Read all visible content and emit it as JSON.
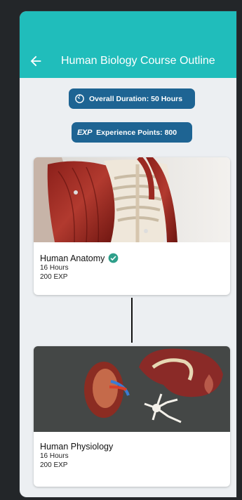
{
  "appbar": {
    "title": "Human Biology Course Outline",
    "back_icon": "arrow-left-icon"
  },
  "summary": {
    "duration_label": "Overall Duration: 50 Hours",
    "exp_badge": "EXP",
    "exp_label": "Experience Points: 800"
  },
  "modules": [
    {
      "name": "Human Anatomy",
      "hours": "16 Hours",
      "exp": "200 EXP",
      "completed": true
    },
    {
      "name": "Human Physiology",
      "hours": "16 Hours",
      "exp": "200 EXP",
      "completed": false
    }
  ],
  "colors": {
    "appbar": "#20bdbb",
    "pill": "#1e6493",
    "check": "#2e9f8a"
  }
}
